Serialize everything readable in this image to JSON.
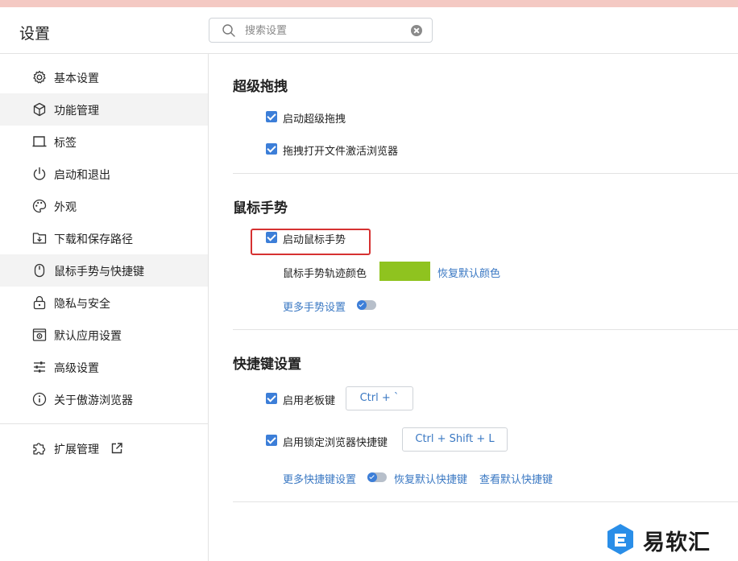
{
  "app": {
    "title": "设置"
  },
  "search": {
    "placeholder": "搜索设置",
    "value": ""
  },
  "sidebar": {
    "items": [
      {
        "label": "基本设置",
        "icon": "gear-icon"
      },
      {
        "label": "功能管理",
        "icon": "cube-icon"
      },
      {
        "label": "标签",
        "icon": "tab-icon"
      },
      {
        "label": "启动和退出",
        "icon": "power-icon"
      },
      {
        "label": "外观",
        "icon": "palette-icon"
      },
      {
        "label": "下载和保存路径",
        "icon": "download-folder-icon"
      },
      {
        "label": "鼠标手势与快捷键",
        "icon": "mouse-icon"
      },
      {
        "label": "隐私与安全",
        "icon": "lock-icon"
      },
      {
        "label": "默认应用设置",
        "icon": "default-app-icon"
      },
      {
        "label": "高级设置",
        "icon": "sliders-icon"
      },
      {
        "label": "关于傲游浏览器",
        "icon": "info-icon"
      }
    ],
    "extensions": {
      "label": "扩展管理",
      "icon": "puzzle-icon",
      "link_icon": "external-link-icon"
    }
  },
  "sections": {
    "super_drag": {
      "title": "超级拖拽",
      "options": [
        {
          "label": "启动超级拖拽",
          "checked": true
        },
        {
          "label": "拖拽打开文件激活浏览器",
          "checked": true
        }
      ]
    },
    "mouse_gesture": {
      "title": "鼠标手势",
      "enable_label": "启动鼠标手势",
      "enable_checked": true,
      "trail_color_label": "鼠标手势轨迹颜色",
      "trail_color": "#8fc31f",
      "restore_color_link": "恢复默认颜色",
      "more_link": "更多手势设置"
    },
    "shortcuts": {
      "title": "快捷键设置",
      "boss_key": {
        "label": "启用老板键",
        "checked": true,
        "key": "Ctrl + `"
      },
      "lock_key": {
        "label": "启用锁定浏览器快捷键",
        "checked": true,
        "key": "Ctrl + Shift + L"
      },
      "more_link": "更多快捷键设置",
      "restore_link": "恢复默认快捷键",
      "view_link": "查看默认快捷键"
    }
  },
  "watermark": {
    "text": "易软汇"
  },
  "colors": {
    "accent": "#3c7ed8",
    "link": "#3a78c3",
    "highlight": "#d63131",
    "active_bg": "#f3f3f3"
  }
}
